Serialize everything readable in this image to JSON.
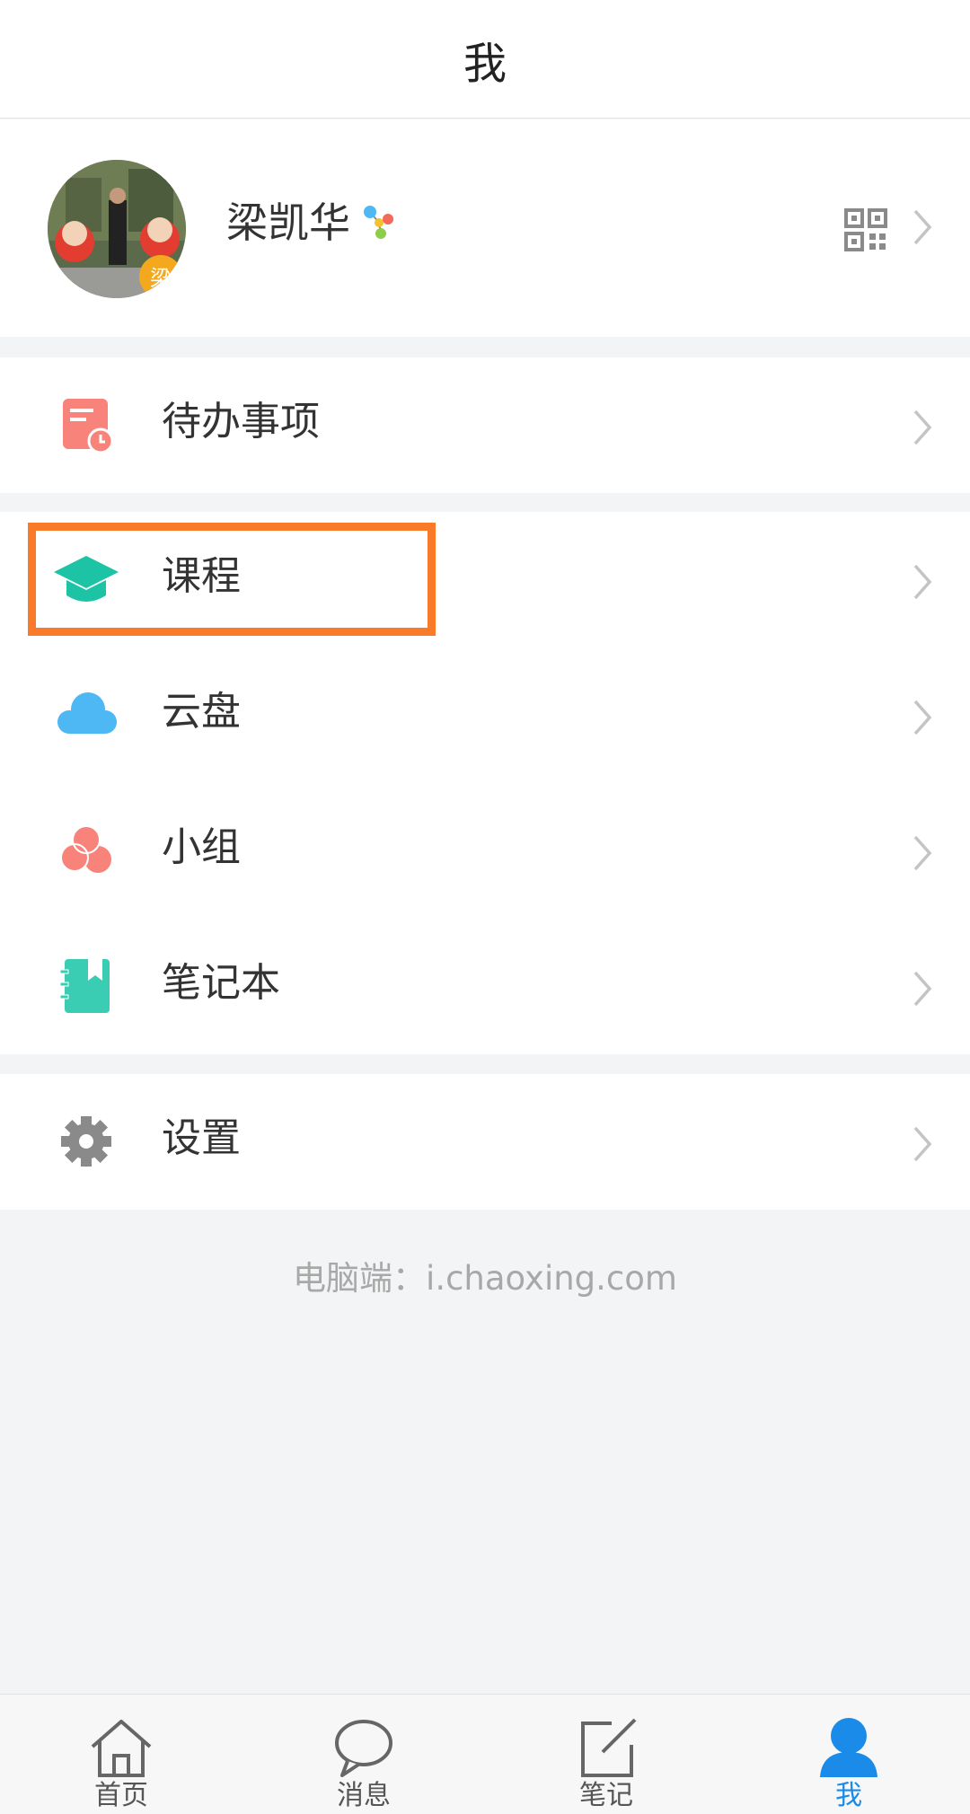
{
  "header": {
    "title": "我"
  },
  "profile": {
    "name": "梁凯华",
    "avatar_badge_text": "梁"
  },
  "menu": {
    "todo": {
      "label": "待办事项",
      "icon": "todo-list-icon"
    },
    "course": {
      "label": "课程",
      "icon": "graduation-cap-icon"
    },
    "cloud": {
      "label": "云盘",
      "icon": "cloud-icon"
    },
    "group": {
      "label": "小组",
      "icon": "group-circles-icon"
    },
    "notebook": {
      "label": "笔记本",
      "icon": "notebook-icon"
    },
    "settings": {
      "label": "设置",
      "icon": "gear-icon"
    }
  },
  "footer": {
    "text": "电脑端：i.chaoxing.com"
  },
  "tabs": [
    {
      "label": "首页",
      "icon": "home-icon",
      "active": false
    },
    {
      "label": "消息",
      "icon": "chat-bubble-icon",
      "active": false
    },
    {
      "label": "笔记",
      "icon": "edit-note-icon",
      "active": false
    },
    {
      "label": "我",
      "icon": "person-icon",
      "active": true
    }
  ],
  "colors": {
    "highlight": "#f97b2a",
    "accent": "#1a8be8",
    "todo": "#f7837b",
    "course": "#1cc3a4",
    "cloud": "#4db8f4",
    "group": "#f7837b",
    "notebook": "#3bcdb4",
    "settings": "#8a8a8a"
  }
}
